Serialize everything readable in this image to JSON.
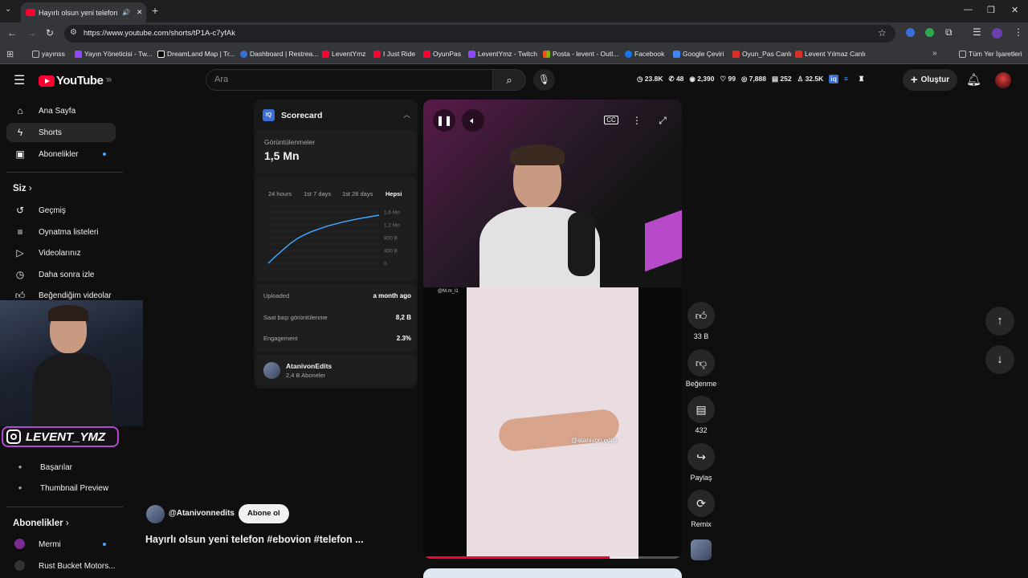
{
  "browser": {
    "tab_title": "Hayırlı olsun yeni telefon #e",
    "url": "https://www.youtube.com/shorts/tP1A-c7yfAk",
    "bookmarks": [
      "yayınss",
      "Yayın Yöneticisi - Tw...",
      "DreamLand Map | Tr...",
      "Dashboard | Restrea...",
      "LeventYmz",
      "I Just Ride",
      "OyunPas",
      "LeventYmz - Twitch",
      "Posta - levent - Outl...",
      "Facebook",
      "Google Çeviri",
      "Oyun_Pas Canlı",
      "Levent Yılmaz Canlı"
    ],
    "all_bookmarks": "Tüm Yer İşaretleri",
    "colors": {
      "accent_red": "#ff0033",
      "link_blue": "#3ea6ff"
    }
  },
  "header": {
    "logo_text": "YouTube",
    "logo_sup": "TR",
    "search_placeholder": "Ara",
    "stats": [
      "23.8K",
      "48",
      "2,390",
      "99",
      "7,888",
      "252",
      "32.5K"
    ],
    "create_label": "Oluştur"
  },
  "sidebar": {
    "items": [
      {
        "label": "Ana Sayfa",
        "icon": "home-icon"
      },
      {
        "label": "Shorts",
        "icon": "shorts-icon"
      },
      {
        "label": "Abonelikler",
        "icon": "subscriptions-icon"
      }
    ],
    "you_heading": "Siz",
    "you_items": [
      {
        "label": "Geçmiş",
        "icon": "history-icon"
      },
      {
        "label": "Oynatma listeleri",
        "icon": "playlist-icon"
      },
      {
        "label": "Videolarınız",
        "icon": "your-videos-icon"
      },
      {
        "label": "Daha sonra izle",
        "icon": "watch-later-icon"
      },
      {
        "label": "Beğendiğim videolar",
        "icon": "liked-icon"
      }
    ],
    "extra_items": [
      {
        "label": "Başarılar",
        "icon": "achievements-icon"
      },
      {
        "label": "Thumbnail Preview",
        "icon": "thumbnail-preview-icon"
      }
    ],
    "subs_heading": "Abonelikler",
    "subs": [
      {
        "label": "Mermi"
      },
      {
        "label": "Rust Bucket Motors..."
      }
    ]
  },
  "overlay": {
    "instagram_handle": "LEVENT_YMZ"
  },
  "scorecard": {
    "title": "Scorecard",
    "views_label": "Görüntülenmeler",
    "views_value": "1,5 Mn",
    "ranges": [
      "24 hours",
      "1st 7 days",
      "1st 28 days",
      "Hepsi"
    ],
    "selected_range": "Hepsi",
    "rows": [
      {
        "label": "Uploaded",
        "value": "a month ago"
      },
      {
        "label": "Saat başı görüntülenme",
        "value": "8,2 B"
      },
      {
        "label": "Engagement",
        "value": "2.3%"
      }
    ],
    "channel_name": "AtanivonEdits",
    "channel_subs": "2,4 B Aboneler"
  },
  "chart_data": {
    "type": "line",
    "y_ticks": [
      "1,6 Mn",
      "1,2 Mn",
      "800 B",
      "400 B",
      "0"
    ],
    "ylim": [
      0,
      1.6
    ],
    "series": [
      {
        "values": [
          0,
          0.22,
          0.42,
          0.62,
          0.78,
          0.9,
          1.0,
          1.08,
          1.16,
          1.22,
          1.28,
          1.33,
          1.38,
          1.42,
          1.46,
          1.5
        ]
      }
    ]
  },
  "video": {
    "watermark_top": "@M.m_l1",
    "watermark_hand": "@atanivon.edits",
    "progress": 0.72,
    "channel_handle": "@Atanivonnedits",
    "subscribe_label": "Abone ol",
    "title": "Hayırlı olsun yeni telefon #ebovion #telefon ..."
  },
  "actions": {
    "like_count": "33 B",
    "dislike_label": "Beğenme",
    "comment_count": "432",
    "share_label": "Paylaş",
    "remix_label": "Remix"
  }
}
